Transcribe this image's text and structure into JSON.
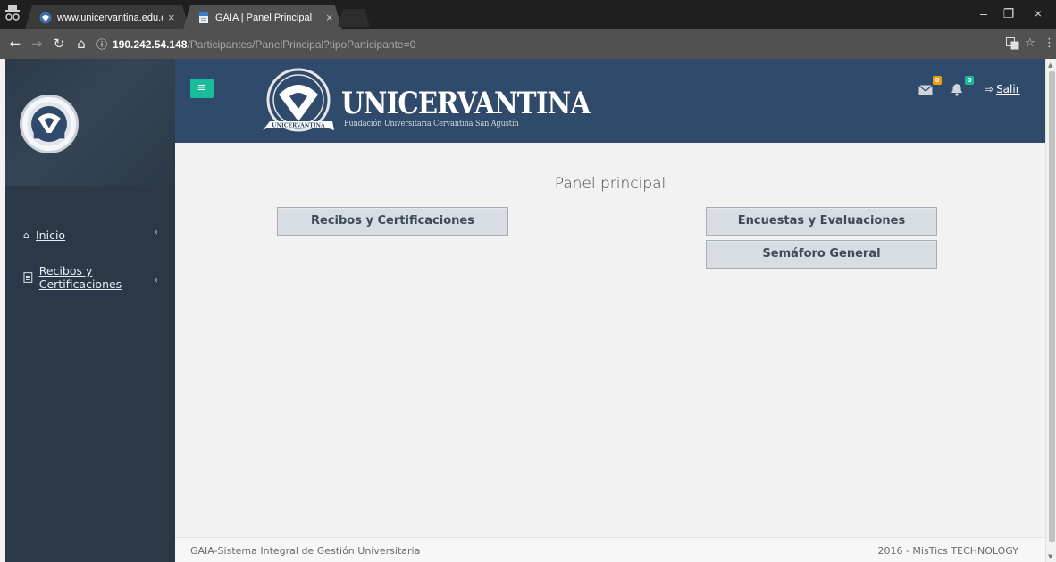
{
  "browser": {
    "tabs": [
      {
        "title": "www.unicervantina.edu.c",
        "active": false
      },
      {
        "title": "GAIA | Panel Principal",
        "active": true
      }
    ],
    "tab_close_glyph": "×",
    "window_controls": {
      "minimize": "–",
      "restore": "❐",
      "close": "×"
    },
    "address": {
      "info_icon": "ⓘ",
      "host": "190.242.54.148",
      "path": "/Participantes/PanelPrincipal?tipoParticipante=0"
    },
    "icons": [
      "incognito-icon",
      "back-icon",
      "forward-icon",
      "reload-icon",
      "home-icon",
      "translate-icon",
      "star-icon",
      "menu-icon"
    ]
  },
  "sidebar": {
    "items": [
      {
        "label": "Inicio",
        "icon": "home-icon"
      },
      {
        "label": "Recibos y Certificaciones",
        "icon": "document-icon"
      }
    ]
  },
  "header": {
    "toggle_glyph": "≡",
    "brand_name": "UNICERVANTINA",
    "brand_subtitle": "Fundación Universitaria Cervantina San Agustín",
    "ribbon_text": "UNICERVANTINA",
    "messages_count": "0",
    "notifications_count": "0",
    "logout_label": "Salir",
    "colors": {
      "header_bg": "#2f4a6b",
      "toggle": "#1abc9c",
      "badge_orange": "#f39c12",
      "badge_green": "#1abc9c"
    }
  },
  "main": {
    "title": "Panel principal",
    "buttons": {
      "recibos": "Recibos y Certificaciones",
      "encuestas": "Encuestas y Evaluaciones",
      "semaforo": "Semáforo General"
    }
  },
  "footer": {
    "left": "GAIA-Sistema Integral de Gestión Universitaria",
    "right": "2016 - MisTics TECHNOLOGY"
  }
}
